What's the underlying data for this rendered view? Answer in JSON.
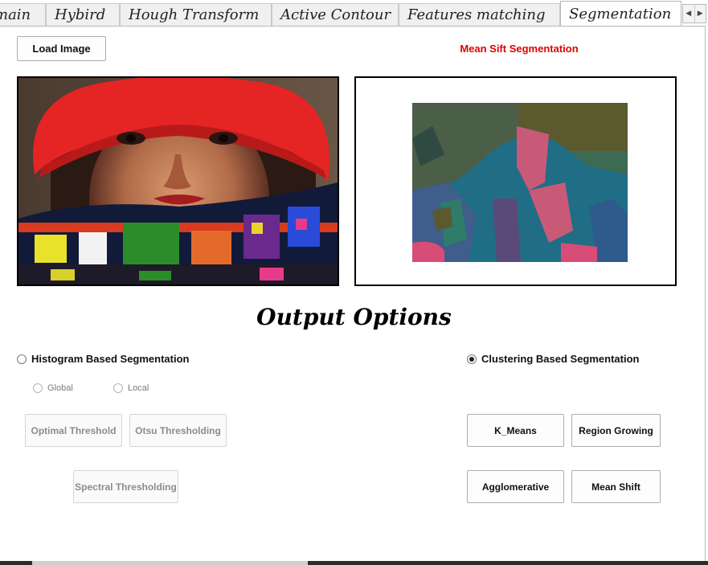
{
  "tabs": [
    {
      "label": "main"
    },
    {
      "label": "Hybird"
    },
    {
      "label": "Hough Transform"
    },
    {
      "label": "Active Contour"
    },
    {
      "label": "Features matching"
    },
    {
      "label": "Segmentation"
    }
  ],
  "active_tab": "Segmentation",
  "toolbar": {
    "load_label": "Load Image"
  },
  "output_title": "Mean Sift Segmentation",
  "colors": {
    "title_red": "#e00000"
  },
  "section_heading": "Output Options",
  "histogram": {
    "label": "Histogram Based Segmentation",
    "selected": false,
    "global_label": "Global",
    "local_label": "Local",
    "buttons": {
      "optimal": "Optimal Threshold",
      "otsu": "Otsu Thresholding",
      "spectral": "Spectral Thresholding"
    }
  },
  "clustering": {
    "label": "Clustering Based Segmentation",
    "selected": true,
    "buttons": {
      "kmeans": "K_Means",
      "region": "Region Growing",
      "agglo": "Agglomerative",
      "meanshift": "Mean Shift"
    }
  }
}
